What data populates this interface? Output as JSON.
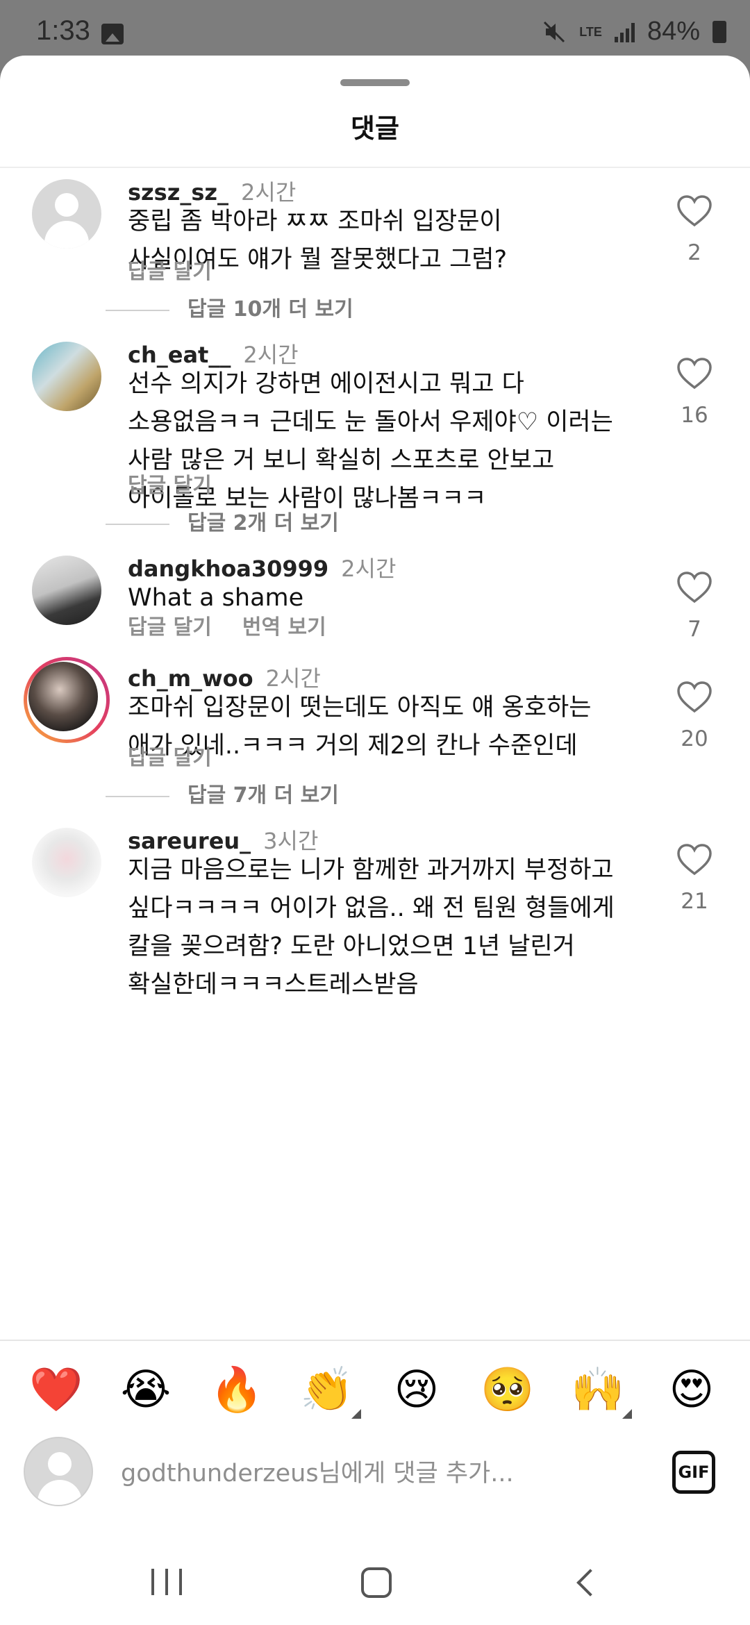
{
  "status_bar": {
    "time": "1:33",
    "network": "LTE",
    "battery": "84%"
  },
  "sheet": {
    "title": "댓글"
  },
  "comments": [
    {
      "username": "szsz_sz_",
      "time": "2시간",
      "text": "중립 좀 박아라 ㅉㅉ 조마쉬 입장문이\n사실이여도 얘가 뭘 잘못했다고 그럼?",
      "reply_label": "답글 달기",
      "likes": "2",
      "more_replies": "답글 10개 더 보기",
      "avatar": "default-avatar"
    },
    {
      "username": "ch_eat__",
      "time": "2시간",
      "text": "선수 의지가 강하면 에이전시고 뭐고 다\n소용없음ㅋㅋ 근데도 눈 돌아서 우제야♡ 이러는\n사람 많은 거 보니 확실히 스포츠로 안보고\n아이돌로 보는 사람이 많나봄ㅋㅋㅋ",
      "reply_label": "답글 달기",
      "likes": "16",
      "more_replies": "답글 2개 더 보기",
      "avatar": "photo"
    },
    {
      "username": "dangkhoa30999",
      "time": "2시간",
      "text": "What a shame",
      "reply_label": "답글 달기",
      "translate_label": "번역 보기",
      "likes": "7",
      "avatar": "photo"
    },
    {
      "username": "ch_m_woo",
      "time": "2시간",
      "text": "조마쉬 입장문이 떳는데도 아직도 얘 옹호하는\n애가 있네..ㅋㅋㅋ 거의 제2의 칸나 수준인데",
      "reply_label": "답글 달기",
      "likes": "20",
      "more_replies": "답글 7개 더 보기",
      "avatar": "photo-with-story-ring"
    },
    {
      "username": "sareureu_",
      "time": "3시간",
      "text": "지금 마음으로는 니가 함께한 과거까지 부정하고\n싶다ㅋㅋㅋㅋ 어이가 없음.. 왜 전 팀원 형들에게\n칼을 꽂으려함? 도란 아니었으면 1년 날린거\n확실한데ㅋㅋㅋ스트레스받음",
      "likes": "21",
      "avatar": "photo"
    }
  ],
  "emoji_bar": [
    "❤️",
    "😭",
    "🔥",
    "👏",
    "😢",
    "🥺",
    "🙌",
    "😍"
  ],
  "input": {
    "placeholder": "godthunderzeus님에게 댓글 추가...",
    "gif_label": "GIF"
  },
  "colors": {
    "status_bar_bg": "#7d7d7d",
    "muted_text": "#8e8e8e",
    "story_ring": "#e4405f"
  }
}
